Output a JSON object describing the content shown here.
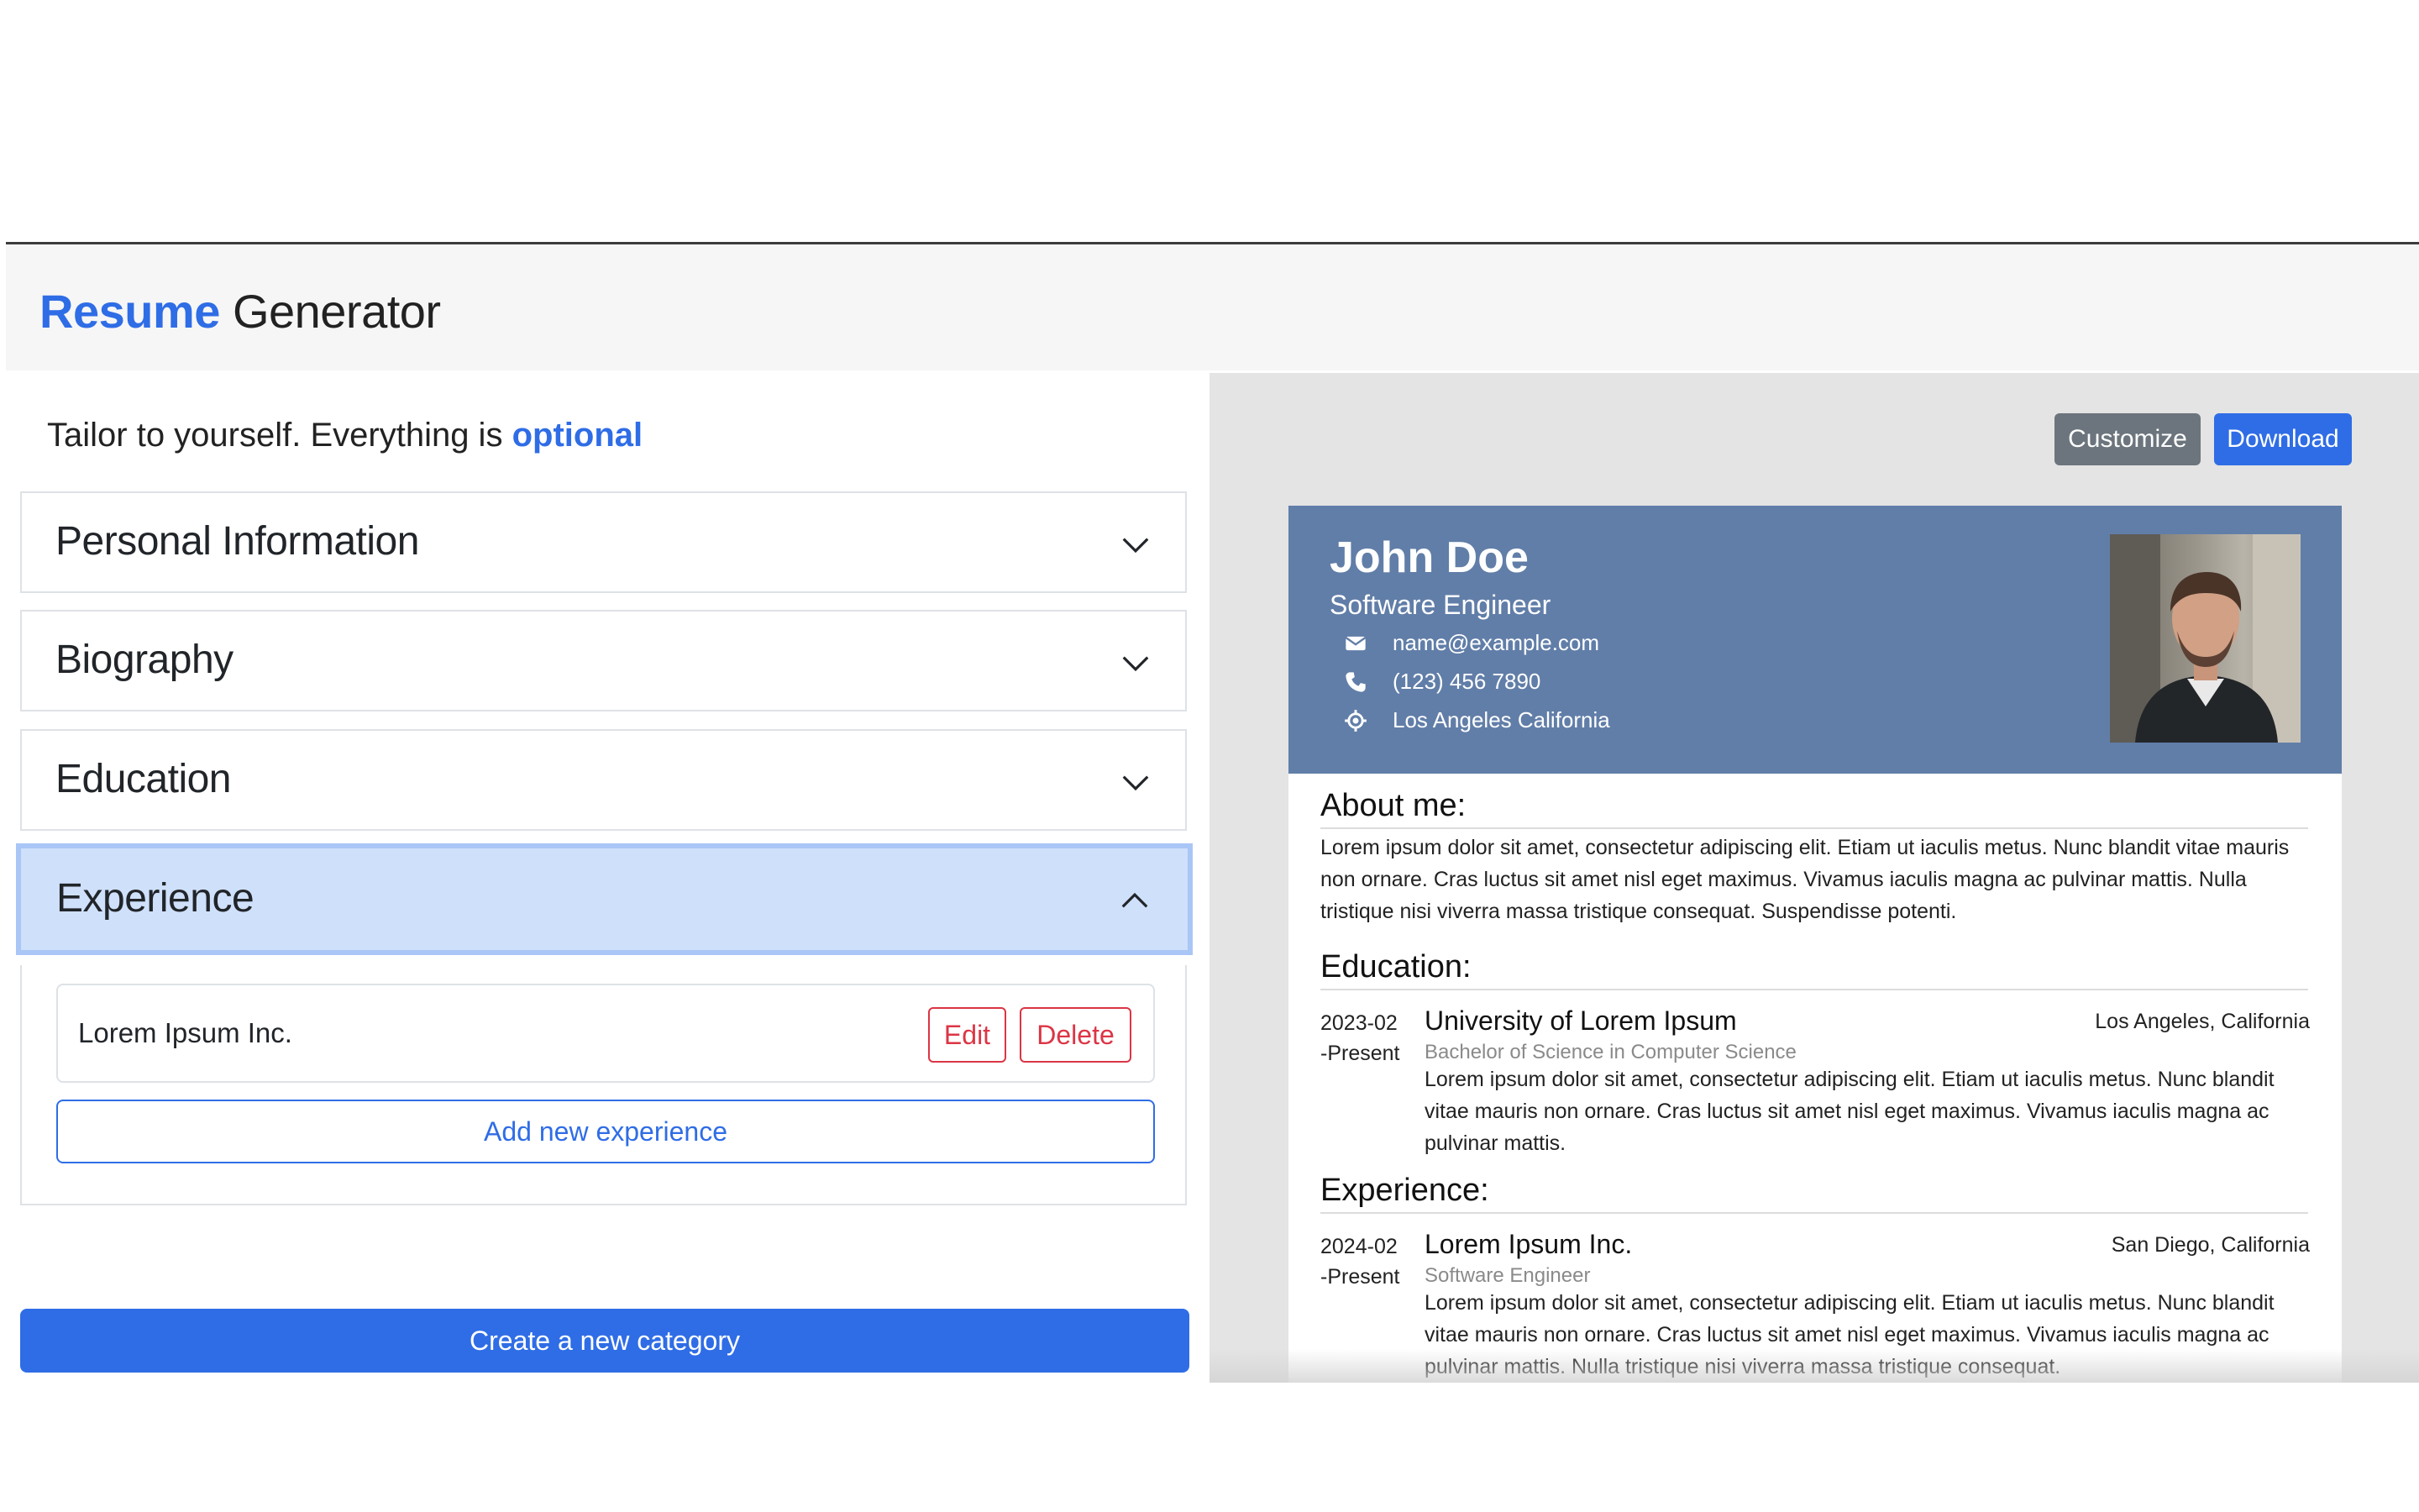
{
  "header": {
    "brand_accent": "Resume",
    "brand_rest": "Generator"
  },
  "form": {
    "tagline_prefix": "Tailor to yourself. Everything is",
    "tagline_highlight": "optional",
    "sections": [
      {
        "label": "Personal Information",
        "expanded": false
      },
      {
        "label": "Biography",
        "expanded": false
      },
      {
        "label": "Education",
        "expanded": false
      },
      {
        "label": "Experience",
        "expanded": true
      }
    ],
    "experience_items": [
      {
        "name": "Lorem Ipsum Inc.",
        "edit_label": "Edit",
        "delete_label": "Delete"
      }
    ],
    "add_experience_label": "Add new experience",
    "create_category_label": "Create a new category"
  },
  "preview": {
    "customize_label": "Customize",
    "download_label": "Download",
    "resume": {
      "name": "John Doe",
      "role": "Software Engineer",
      "email": "name@example.com",
      "phone": "(123) 456 7890",
      "location": "Los Angeles California",
      "about_title": "About me:",
      "about_text": "Lorem ipsum dolor sit amet, consectetur adipiscing elit. Etiam ut iaculis metus. Nunc blandit vitae mauris non ornare. Cras luctus sit amet nisl eget maximus. Vivamus iaculis magna ac pulvinar mattis. Nulla tristique nisi viverra massa tristique consequat. Suspendisse potenti.",
      "education_title": "Education:",
      "education": [
        {
          "date_start": "2023-02",
          "date_end": "-Present",
          "org": "University of Lorem Ipsum",
          "location": "Los Angeles, California",
          "subtitle": "Bachelor of Science in Computer Science",
          "description": "Lorem ipsum dolor sit amet, consectetur adipiscing elit. Etiam ut iaculis metus. Nunc blandit vitae mauris non ornare. Cras luctus sit amet nisl eget maximus. Vivamus iaculis magna ac pulvinar mattis."
        }
      ],
      "experience_title": "Experience:",
      "experience": [
        {
          "date_start": "2024-02",
          "date_end": "-Present",
          "org": "Lorem Ipsum Inc.",
          "location": "San Diego, California",
          "subtitle": "Software Engineer",
          "description": "Lorem ipsum dolor sit amet, consectetur adipiscing elit. Etiam ut iaculis metus. Nunc blandit vitae mauris non ornare. Cras luctus sit amet nisl eget maximus. Vivamus iaculis magna ac pulvinar mattis. Nulla tristique nisi viverra massa tristique consequat."
        }
      ]
    }
  },
  "colors": {
    "accent": "#2f6de6",
    "header_band": "#617ea8",
    "danger": "#dc3545",
    "secondary": "#6c757d"
  },
  "icons": [
    "chevron-down-icon",
    "chevron-up-icon",
    "envelope-icon",
    "phone-icon",
    "location-icon"
  ]
}
